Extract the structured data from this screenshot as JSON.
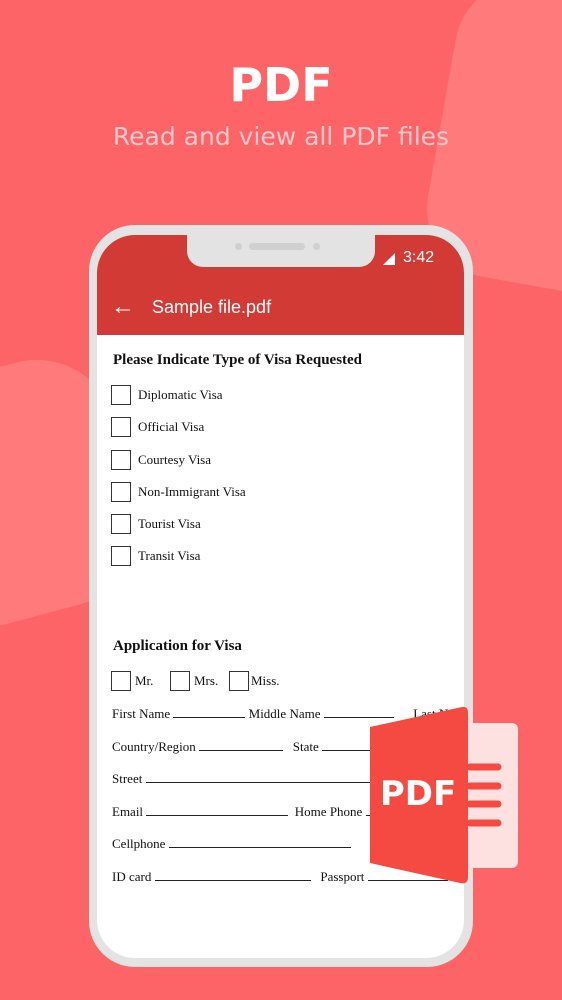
{
  "promo": {
    "title": "PDF",
    "subtitle": "Read and view all PDF files"
  },
  "status": {
    "time": "3:42"
  },
  "appbar": {
    "title": "Sample file.pdf"
  },
  "doc": {
    "section1": "Please Indicate Type of Visa Requested",
    "visa_types": [
      "Diplomatic Visa",
      "Official Visa",
      "Courtesy Visa",
      "Non-Immigrant Visa",
      "Tourist Visa",
      "Transit Visa"
    ],
    "section2": "Application for Visa",
    "titles": [
      "Mr.",
      "Mrs.",
      "Miss."
    ],
    "fields": {
      "first": "First Name",
      "middle": "Middle Name",
      "last": "Last N",
      "country": "Country/Region",
      "state": "State",
      "street": "Street",
      "email": "Email",
      "home": "Home Phone",
      "cell": "Cellphone",
      "id": "ID card",
      "passport": "Passport"
    }
  },
  "badge": {
    "label": "PDF"
  },
  "colors": {
    "background": "#fd6467",
    "appbar": "#d23b35",
    "icon": "#f44a42"
  }
}
